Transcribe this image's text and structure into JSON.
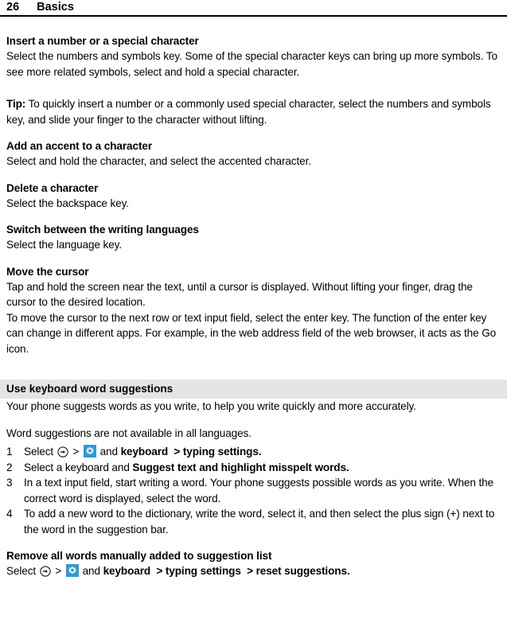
{
  "header": {
    "page_number": "26",
    "chapter": "Basics"
  },
  "sections": [
    {
      "heading": "Insert a number or a special character",
      "paragraph": "Select the numbers and symbols key. Some of the special character keys can bring up more symbols. To see more related symbols, select and hold a special character."
    },
    {
      "tip_label": "Tip:",
      "tip_text": " To quickly insert a number or a commonly used special character, select the numbers and symbols key, and slide your finger to the character without lifting."
    },
    {
      "heading": "Add an accent to a character",
      "paragraph": "Select and hold the character, and select the accented character."
    },
    {
      "heading": "Delete a character",
      "paragraph": "Select the backspace key."
    },
    {
      "heading": "Switch between the writing languages",
      "paragraph": "Select the language key."
    },
    {
      "heading": "Move the cursor",
      "paragraph": "Tap and hold the screen near the text, until a cursor is displayed. Without lifting your finger, drag the cursor to the desired location.",
      "paragraph2": "To move the cursor to the next row or text input field, select the enter key. The function of the enter key can change in different apps. For example, in the web address field of the web browser, it acts as the Go icon."
    }
  ],
  "word_suggestions": {
    "band_heading": "Use keyboard word suggestions",
    "intro": "Your phone suggests words as you write, to help you write quickly and more accurately.",
    "note": "Word suggestions are not available in all languages.",
    "steps": [
      {
        "number": "1",
        "select_label": "Select",
        "icon_arrow": "arrow-circle-icon",
        "sep1": ">",
        "icon_gear": "gear-icon",
        "and_label": "and",
        "bold1": "keyboard",
        "sep2": ">",
        "bold2": "typing settings",
        "period": "."
      },
      {
        "number": "2",
        "text_before": "Select a keyboard and ",
        "bold": "Suggest text and highlight misspelt words",
        "text_after": "."
      },
      {
        "number": "3",
        "text": "In a text input field, start writing a word. Your phone suggests possible words as you write. When the correct word is displayed, select the word."
      },
      {
        "number": "4",
        "text": "To add a new word to the dictionary, write the word, select it, and then select the plus sign (+) next to the word in the suggestion bar."
      }
    ]
  },
  "remove_words": {
    "heading": "Remove all words manually added to suggestion list",
    "select_label": "Select",
    "icon_arrow": "arrow-circle-icon",
    "sep1": ">",
    "icon_gear": "gear-icon",
    "and_label": "and",
    "bold1": "keyboard",
    "sep2": ">",
    "bold2": "typing settings",
    "sep3": ">",
    "bold3": "reset suggestions",
    "period": "."
  },
  "colors": {
    "gear_blue": "#2e9ad6",
    "band_gray": "#e4e4e4",
    "text": "#000000"
  }
}
